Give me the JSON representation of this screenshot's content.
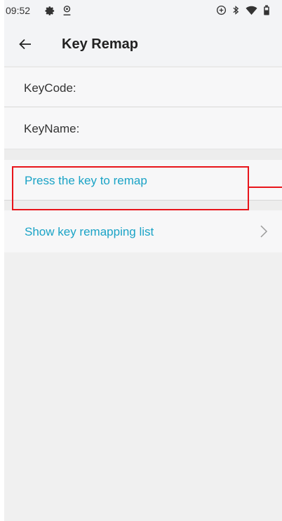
{
  "status_bar": {
    "time": "09:52",
    "left_icons": [
      "settings-icon",
      "location-icon"
    ],
    "right_icons": [
      "sync-icon",
      "bluetooth-icon",
      "wifi-icon",
      "battery-icon"
    ]
  },
  "app_bar": {
    "back_icon": "arrow-back-icon",
    "title": "Key Remap"
  },
  "fields": {
    "keycode_label": "KeyCode:",
    "keyname_label": "KeyName:"
  },
  "actions": {
    "press_key": "Press the key to remap",
    "show_list": "Show key remapping list",
    "show_list_icon": "chevron-right-icon"
  },
  "colors": {
    "accent": "#1aa3c6",
    "annotation": "#e8141a"
  }
}
